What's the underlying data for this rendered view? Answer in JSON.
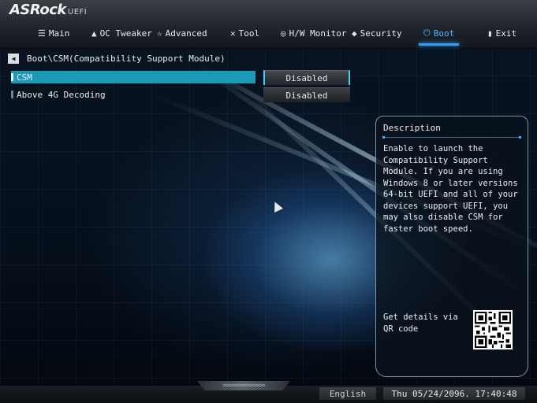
{
  "brand": {
    "name": "ASRock",
    "sub": "UEFI"
  },
  "tabs": [
    {
      "label": "Main",
      "icon": "list-icon",
      "glyph": "☰"
    },
    {
      "label": "OC Tweaker",
      "icon": "rocket-icon",
      "glyph": "▲"
    },
    {
      "label": "Advanced",
      "icon": "star-icon",
      "glyph": "☆"
    },
    {
      "label": "Tool",
      "icon": "tools-icon",
      "glyph": "✕"
    },
    {
      "label": "H/W Monitor",
      "icon": "monitor-icon",
      "glyph": "◎"
    },
    {
      "label": "Security",
      "icon": "shield-icon",
      "glyph": "◆"
    },
    {
      "label": "Boot",
      "icon": "power-icon",
      "glyph": "⏻"
    },
    {
      "label": "Exit",
      "icon": "exit-icon",
      "glyph": "▮"
    }
  ],
  "active_tab": "Boot",
  "breadcrumb": {
    "back_icon": "back-arrow-icon",
    "back_glyph": "◀",
    "path": "Boot\\CSM(Compatibility Support Module)"
  },
  "settings": [
    {
      "label": "CSM",
      "value": "Disabled",
      "selected": true
    },
    {
      "label": "Above 4G Decoding",
      "value": "Disabled",
      "selected": false
    }
  ],
  "description": {
    "title": "Description",
    "text": "Enable to launch the Compatibility Support Module. If you are using Windows 8 or later versions 64-bit UEFI and all of your devices support UEFI, you may also disable CSM for faster boot speed.",
    "qr_label": "Get details via QR code"
  },
  "footer": {
    "chevrons": ">>>>>>>>>>>>>>",
    "language": "English",
    "datetime": "Thu 05/24/2096. 17:40:48"
  },
  "colors": {
    "accent": "#2aa0ff",
    "selected_row": "#1b9ab8",
    "selected_value_border": "#2fd6ff"
  }
}
